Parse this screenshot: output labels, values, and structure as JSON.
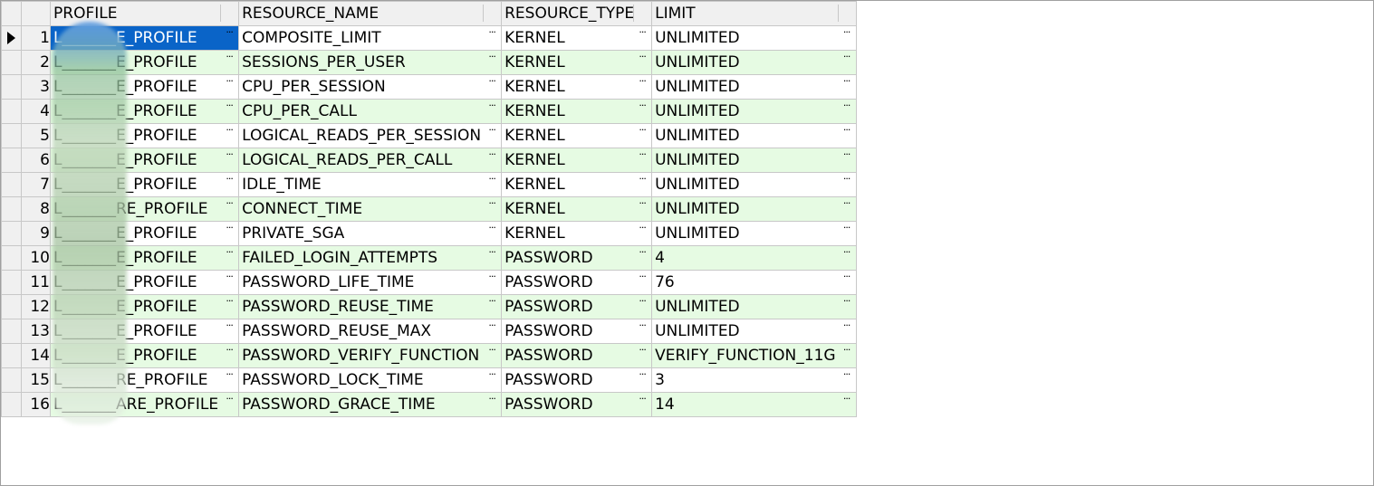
{
  "grid": {
    "headers": [
      "PROFILE",
      "RESOURCE_NAME",
      "RESOURCE_TYPE",
      "LIMIT"
    ],
    "cell_button_glyph": "···",
    "rows": [
      {
        "num": "1",
        "profile": "L_______E_PROFILE",
        "resource_name": "COMPOSITE_LIMIT",
        "resource_type": "KERNEL",
        "limit": "UNLIMITED"
      },
      {
        "num": "2",
        "profile": "L_______E_PROFILE",
        "resource_name": "SESSIONS_PER_USER",
        "resource_type": "KERNEL",
        "limit": "UNLIMITED"
      },
      {
        "num": "3",
        "profile": "L_______E_PROFILE",
        "resource_name": "CPU_PER_SESSION",
        "resource_type": "KERNEL",
        "limit": "UNLIMITED"
      },
      {
        "num": "4",
        "profile": "L_______E_PROFILE",
        "resource_name": "CPU_PER_CALL",
        "resource_type": "KERNEL",
        "limit": "UNLIMITED"
      },
      {
        "num": "5",
        "profile": "L_______E_PROFILE",
        "resource_name": "LOGICAL_READS_PER_SESSION",
        "resource_type": "KERNEL",
        "limit": "UNLIMITED"
      },
      {
        "num": "6",
        "profile": "L_______E_PROFILE",
        "resource_name": "LOGICAL_READS_PER_CALL",
        "resource_type": "KERNEL",
        "limit": "UNLIMITED"
      },
      {
        "num": "7",
        "profile": "L_______E_PROFILE",
        "resource_name": "IDLE_TIME",
        "resource_type": "KERNEL",
        "limit": "UNLIMITED"
      },
      {
        "num": "8",
        "profile": "L_______RE_PROFILE",
        "resource_name": "CONNECT_TIME",
        "resource_type": "KERNEL",
        "limit": "UNLIMITED"
      },
      {
        "num": "9",
        "profile": "L_______E_PROFILE",
        "resource_name": "PRIVATE_SGA",
        "resource_type": "KERNEL",
        "limit": "UNLIMITED"
      },
      {
        "num": "10",
        "profile": "L_______E_PROFILE",
        "resource_name": "FAILED_LOGIN_ATTEMPTS",
        "resource_type": "PASSWORD",
        "limit": "4"
      },
      {
        "num": "11",
        "profile": "L_______E_PROFILE",
        "resource_name": "PASSWORD_LIFE_TIME",
        "resource_type": "PASSWORD",
        "limit": "76"
      },
      {
        "num": "12",
        "profile": "L_______E_PROFILE",
        "resource_name": "PASSWORD_REUSE_TIME",
        "resource_type": "PASSWORD",
        "limit": "UNLIMITED"
      },
      {
        "num": "13",
        "profile": "L_______E_PROFILE",
        "resource_name": "PASSWORD_REUSE_MAX",
        "resource_type": "PASSWORD",
        "limit": "UNLIMITED"
      },
      {
        "num": "14",
        "profile": "L_______E_PROFILE",
        "resource_name": "PASSWORD_VERIFY_FUNCTION",
        "resource_type": "PASSWORD",
        "limit": "VERIFY_FUNCTION_11G"
      },
      {
        "num": "15",
        "profile": "L_______RE_PROFILE",
        "resource_name": "PASSWORD_LOCK_TIME",
        "resource_type": "PASSWORD",
        "limit": "3"
      },
      {
        "num": "16",
        "profile": "L_______ARE_PROFILE",
        "resource_name": "PASSWORD_GRACE_TIME",
        "resource_type": "PASSWORD",
        "limit": "14"
      }
    ]
  }
}
